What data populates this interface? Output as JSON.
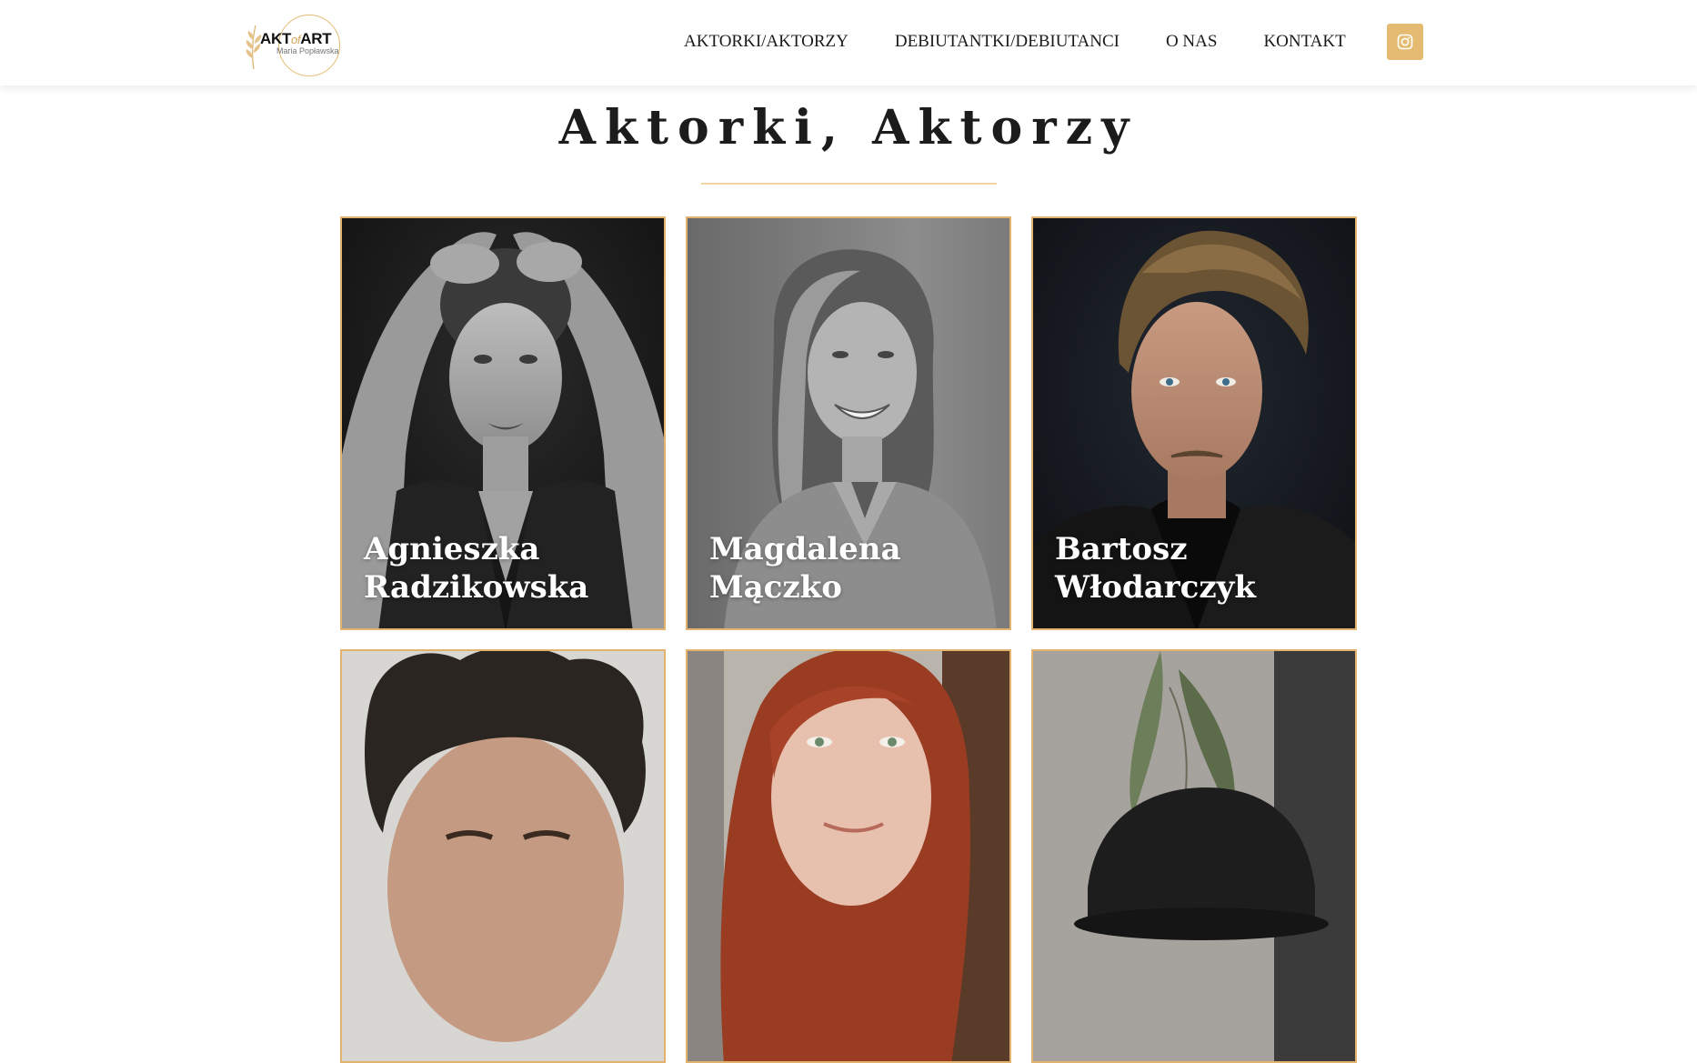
{
  "brand": {
    "wordmark_left": "AKT",
    "wordmark_mid": "of",
    "wordmark_right": "ART",
    "subtitle": "Maria Popławska",
    "accent_color": "#e5bb71"
  },
  "nav": {
    "items": [
      {
        "label": "AKTORKI/AKTORZY"
      },
      {
        "label": "DEBIUTANTKI/DEBIUTANCI"
      },
      {
        "label": "O NAS"
      },
      {
        "label": "KONTAKT"
      }
    ],
    "social_icon": "instagram-icon"
  },
  "page": {
    "title": "Aktorki, Aktorzy"
  },
  "actors": [
    {
      "name": "Agnieszka\nRadzikowska",
      "photo_tone": "bw-dark"
    },
    {
      "name": "Magdalena\nMączko",
      "photo_tone": "bw-light"
    },
    {
      "name": "Bartosz\nWłodarczyk",
      "photo_tone": "color-dark"
    },
    {
      "name": "",
      "photo_tone": "color-light"
    },
    {
      "name": "",
      "photo_tone": "color-warm"
    },
    {
      "name": "",
      "photo_tone": "color-grey"
    }
  ]
}
